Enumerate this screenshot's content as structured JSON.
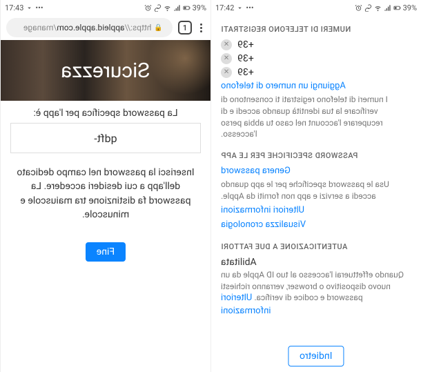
{
  "status": {
    "batt": "39%",
    "time_left": "17:43",
    "time_right": "17:42"
  },
  "browser": {
    "url_scheme": "https://",
    "url_host": "appleid.apple.com",
    "url_path": "/manage",
    "tab_count": "1"
  },
  "hero": {
    "title": "Sicurezza"
  },
  "pw": {
    "label": "La password specifica per l'app è:",
    "value": "qdft-",
    "help": "Inserisci la password nel campo dedicato dell'app a cui desideri accedere. La password fa distinzione tra maiuscole e minuscole.",
    "done": "Fine"
  },
  "phones": {
    "heading": "NUMERI DI TELEFONO REGISTRATI",
    "items": [
      "+39",
      "+39",
      "+39"
    ],
    "add_link": "Aggiungi un numero di telefono",
    "desc": "I numeri di telefono registrati ti consentono di verificare la tua identità quando accedi e di recuperare l'account nel caso tu abbia perso l'accesso."
  },
  "apps": {
    "heading": "PASSWORD SPECIFICHE PER LE APP",
    "gen_link": "Genera password",
    "desc": "Usa le password specifiche per le app quando accedi a servizi e app non forniti da Apple.",
    "more_link": "Ulteriori informazioni",
    "history_link": "Visualizza cronologia"
  },
  "tfa": {
    "heading": "AUTENTICAZIONE A DUE FATTORI",
    "status": "Abilitata",
    "desc_pre": "Quando effettuerai l'accesso al tuo ID Apple da un nuovo dispositivo o browser, verranno richiesti password e codice di verifica. ",
    "more_link": "Ulteriori informazioni"
  },
  "back": "Indietro"
}
